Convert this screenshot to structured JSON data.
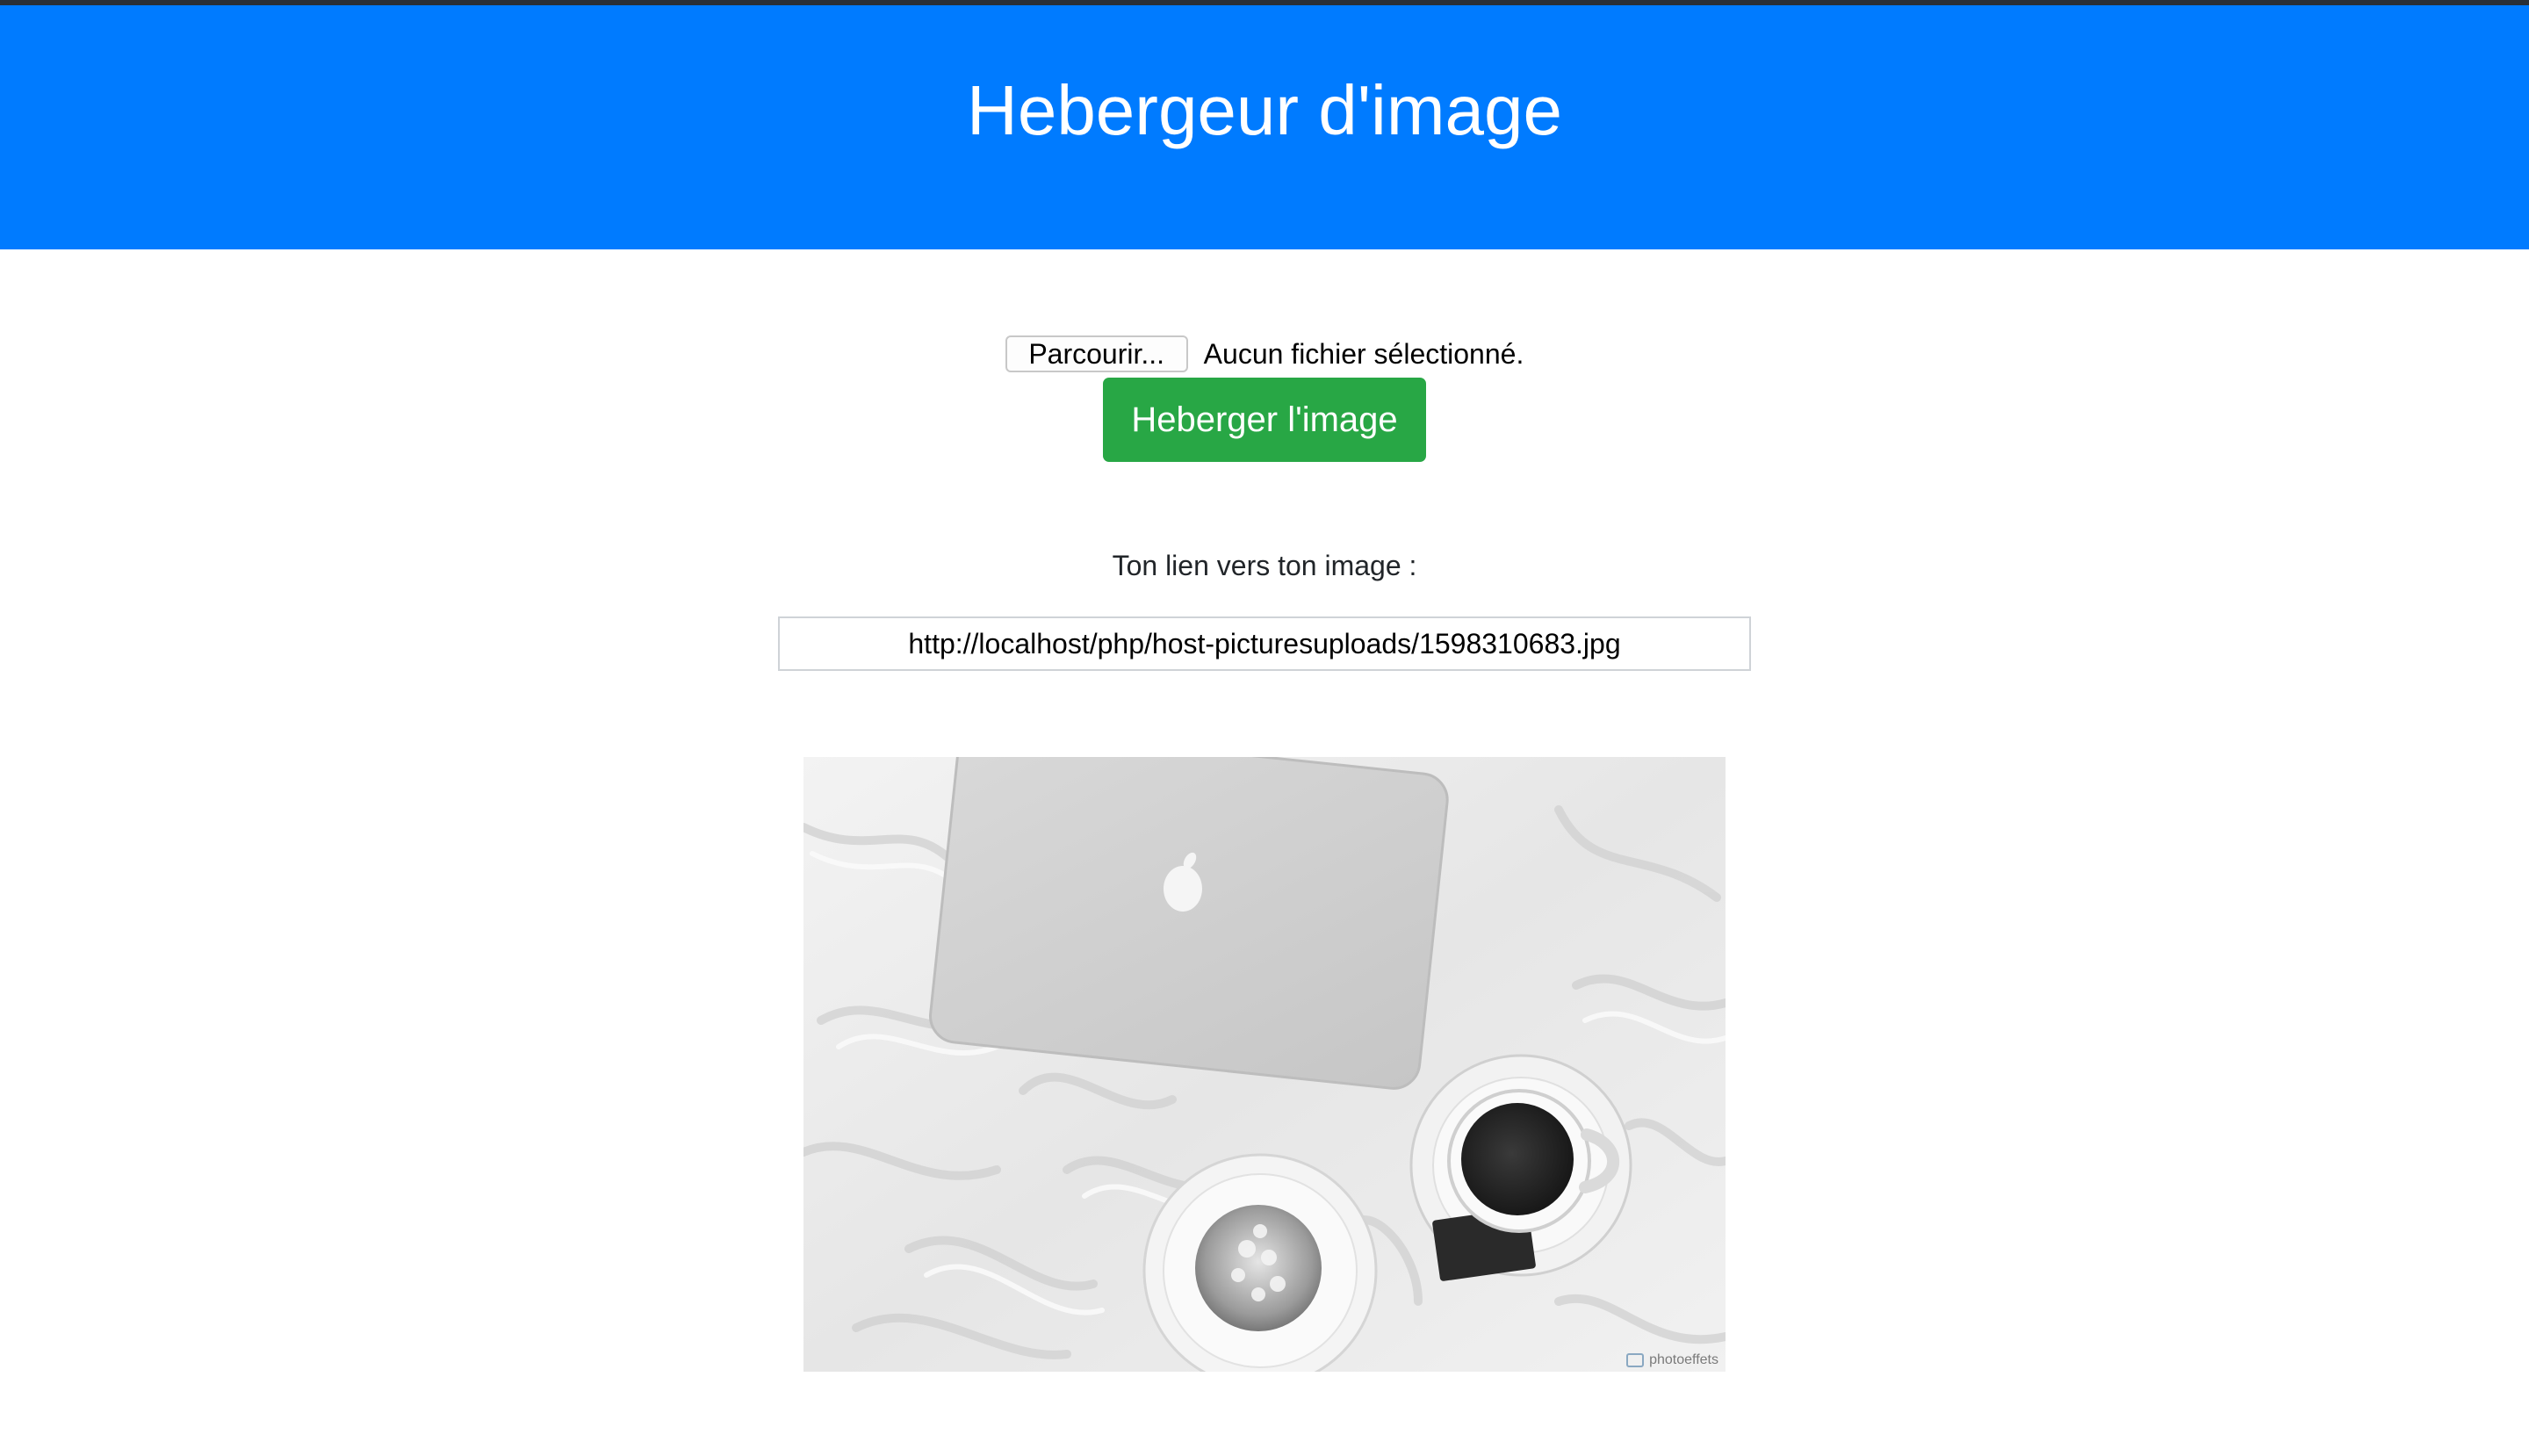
{
  "header": {
    "title": "Hebergeur d'image"
  },
  "upload": {
    "browse_label": "Parcourir...",
    "file_status": "Aucun fichier sélectionné.",
    "submit_label": "Heberger l'image"
  },
  "result": {
    "link_label": "Ton lien vers ton image :",
    "link_value": "http://localhost/php/host-picturesuploads/1598310683.jpg"
  },
  "image": {
    "alt": "Uploaded image",
    "watermark": "photoeffets"
  },
  "colors": {
    "header_bg": "#007bff",
    "button_success": "#28a745"
  }
}
